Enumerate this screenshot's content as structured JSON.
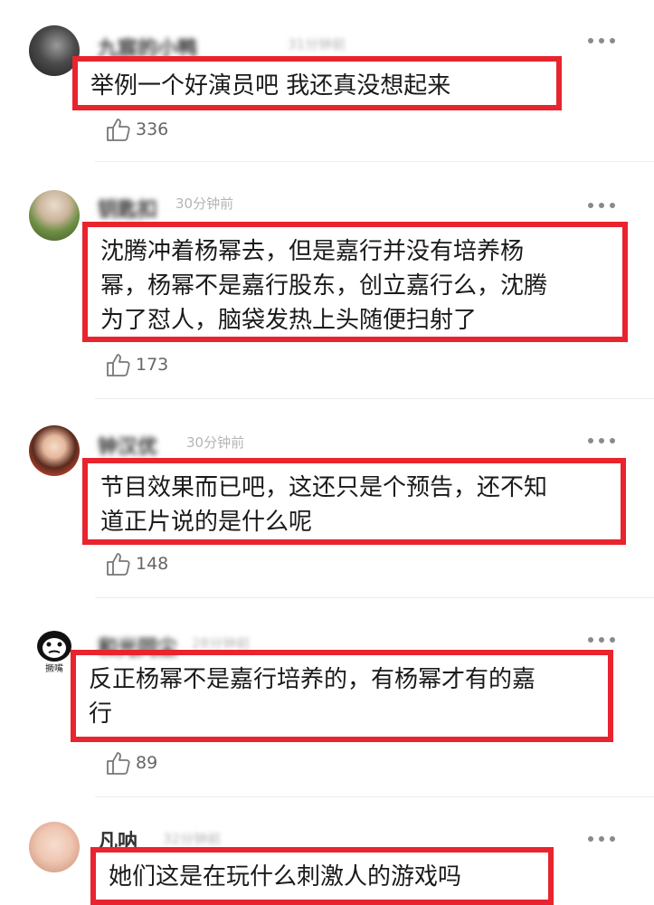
{
  "comments": [
    {
      "username": "九宸的小鸭",
      "time": "31分钟前",
      "text": "举例一个好演员吧 我还真没想起来",
      "likes": "336",
      "avatar_colors": [
        "#3a3a3a",
        "#8a8a8a"
      ]
    },
    {
      "username": "钥匙扣",
      "time": "30分钟前",
      "text": "沈腾冲着杨幂去，但是嘉行并没有培养杨\n幂，杨幂不是嘉行股东，创立嘉行么，沈腾\n为了怼人，脑袋发热上头随便扫射了",
      "likes": "173",
      "avatar_colors": [
        "#5b7a3a",
        "#d9c9b8"
      ]
    },
    {
      "username": "钟汉优",
      "time": "30分钟前",
      "text": "节目效果而已吧，这还只是个预告，还不知\n道正片说的是什么呢",
      "likes": "148",
      "avatar_colors": [
        "#c94a2e",
        "#f0d6c4"
      ]
    },
    {
      "username": "和光同尘",
      "time": "28分钟前",
      "text": "反正杨幂不是嘉行培养的，有杨幂才有的嘉\n行",
      "likes": "89",
      "avatar_colors": [
        "#ffffff",
        "#111111"
      ],
      "avatar_caption": "撅嘴"
    },
    {
      "username": "凡呐",
      "time": "32分钟前",
      "text": "她们这是在玩什么刺激人的游戏吗",
      "likes": "",
      "avatar_colors": [
        "#f3d3c3",
        "#d99a82"
      ]
    }
  ],
  "icons": {
    "like": "thumbs-up-icon",
    "more": "more-dots-icon"
  },
  "colors": {
    "highlight_border": "#e8242e",
    "text": "#1a1a1a",
    "meta": "#b5b5b5"
  }
}
